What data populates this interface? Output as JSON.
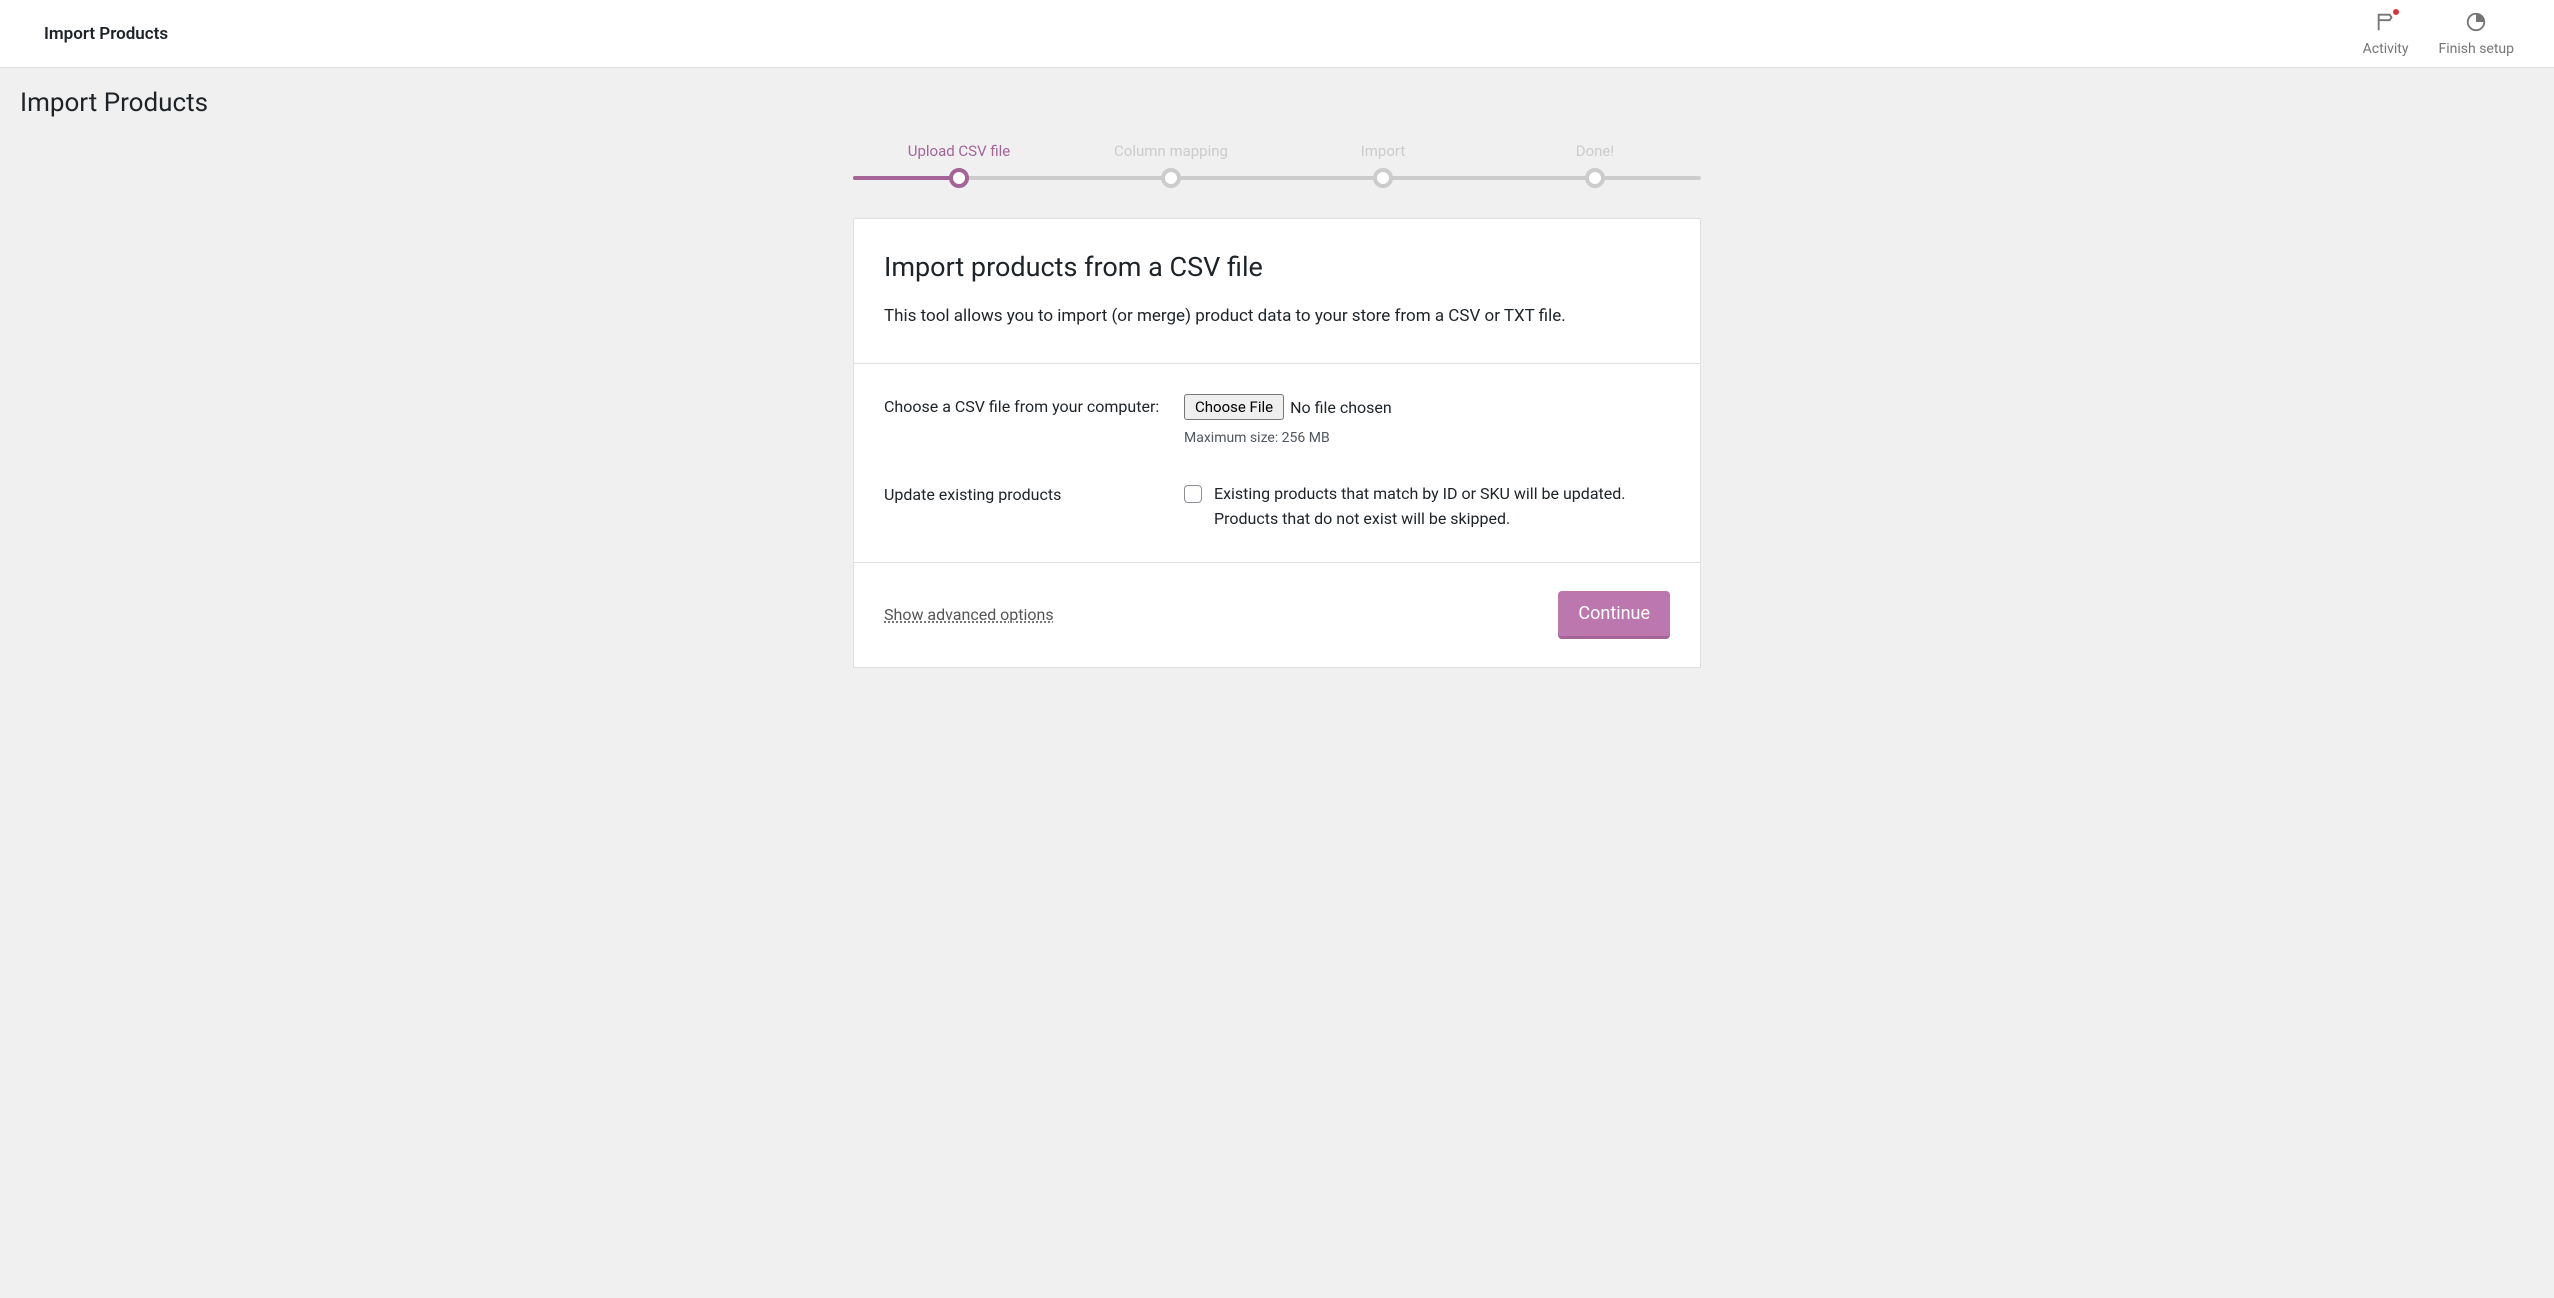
{
  "topbar": {
    "title": "Import Products",
    "activity_label": "Activity",
    "finish_setup_label": "Finish setup"
  },
  "page": {
    "heading": "Import Products"
  },
  "steps": [
    {
      "label": "Upload CSV file",
      "active": true
    },
    {
      "label": "Column mapping",
      "active": false
    },
    {
      "label": "Import",
      "active": false
    },
    {
      "label": "Done!",
      "active": false
    }
  ],
  "card": {
    "title": "Import products from a CSV file",
    "description": "This tool allows you to import (or merge) product data to your store from a CSV or TXT file.",
    "file_label": "Choose a CSV file from your computer:",
    "file_button": "Choose File",
    "file_status": "No file chosen",
    "file_hint": "Maximum size: 256 MB",
    "update_label": "Update existing products",
    "update_description": "Existing products that match by ID or SKU will be updated. Products that do not exist will be skipped.",
    "advanced_link": "Show advanced options",
    "continue_button": "Continue"
  }
}
